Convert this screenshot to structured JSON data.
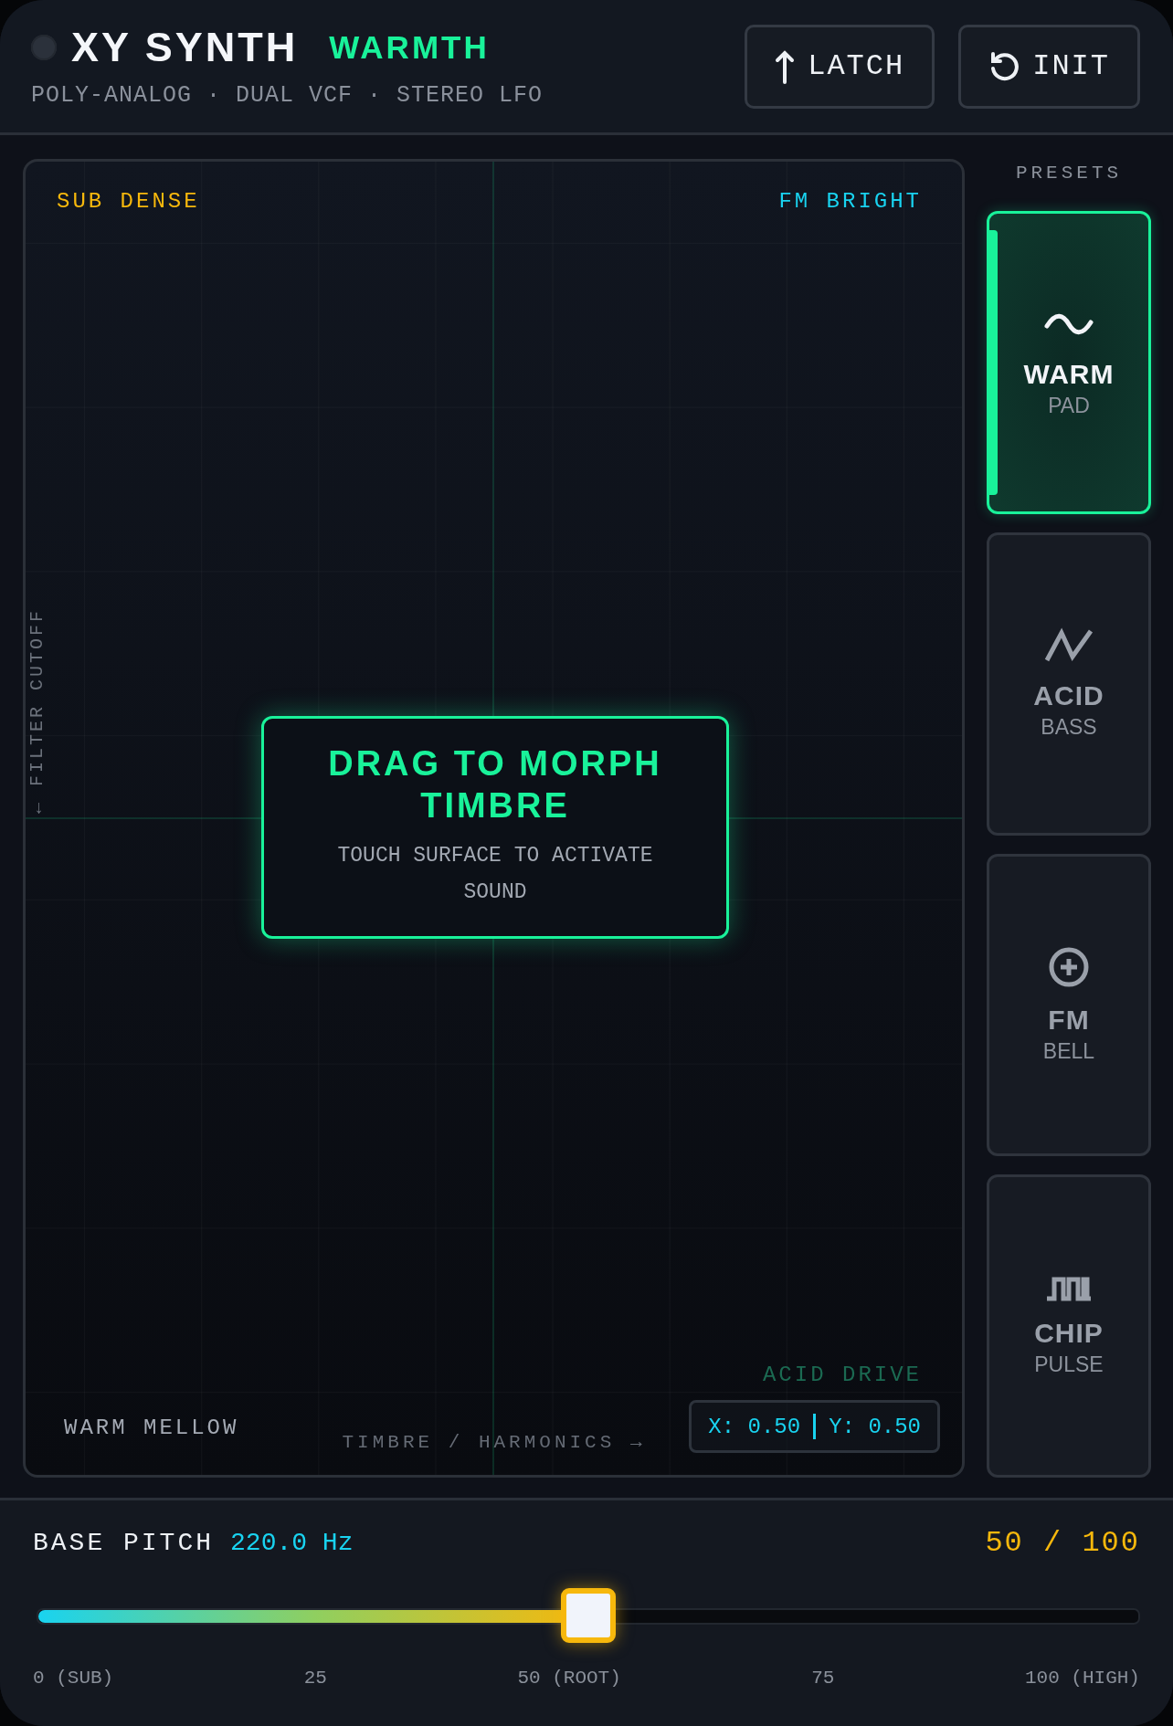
{
  "header": {
    "title": "XY SYNTH",
    "preset_name": "WARMTH",
    "subtitle": "POLY-ANALOG · DUAL VCF · STEREO LFO",
    "power_on": false,
    "buttons": [
      {
        "kind": "latch",
        "label": "LATCH"
      },
      {
        "kind": "init",
        "label": "INIT"
      }
    ]
  },
  "pad": {
    "corners": {
      "top_left": "SUB DENSE",
      "top_right": "FM BRIGHT",
      "bottom_left": "WARM MELLOW",
      "bottom_right": "ACID DRIVE"
    },
    "x_axis": "TIMBRE / HARMONICS →",
    "y_axis": "← FILTER CUTOFF",
    "overlay": {
      "title": "DRAG TO MORPH TIMBRE",
      "hint": "TOUCH SURFACE TO ACTIVATE SOUND"
    },
    "readout": {
      "x": "X: 0.50",
      "y": "Y: 0.50"
    }
  },
  "presets": {
    "title": "PRESETS",
    "items": [
      {
        "kind": "sine",
        "name": "WARM",
        "sub": "PAD",
        "selected": true
      },
      {
        "kind": "zigzag",
        "name": "ACID",
        "sub": "BASS",
        "selected": false
      },
      {
        "kind": "plus",
        "name": "FM",
        "sub": "BELL",
        "selected": false
      },
      {
        "kind": "pulse",
        "name": "CHIP",
        "sub": "PULSE",
        "selected": false
      }
    ]
  },
  "pitch": {
    "label": "BASE PITCH",
    "frequency": "220.0 Hz",
    "value": "50 / 100",
    "level": 0.5,
    "ticks": [
      "0 (SUB)",
      "25",
      "50 (ROOT)",
      "75",
      "100 (HIGH)"
    ]
  }
}
